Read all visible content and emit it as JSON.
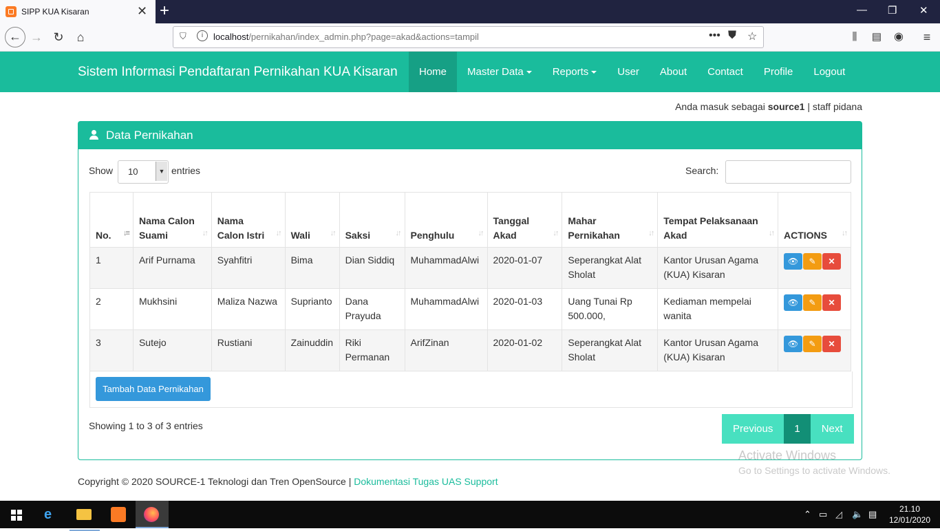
{
  "browser": {
    "tab_title": "SIPP KUA Kisaran",
    "url_host": "localhost",
    "url_path": "/pernikahan/index_admin.php?page=akad&actions=tampil"
  },
  "site": {
    "brand": "Sistem Informasi Pendaftaran Pernikahan KUA Kisaran",
    "menu": [
      "Home",
      "Master Data",
      "Reports",
      "User",
      "About",
      "Contact",
      "Profile",
      "Logout"
    ],
    "login_prefix": "Anda masuk sebagai",
    "login_user": "source1",
    "login_suffix": "| staff pidana"
  },
  "panel": {
    "title": "Data Pernikahan",
    "show_label": "Show",
    "entries_label": "entries",
    "page_length": "10",
    "search_label": "Search:",
    "search_value": ""
  },
  "table": {
    "columns": [
      "No.",
      "Nama Calon Suami",
      "Nama Calon Istri",
      "Wali",
      "Saksi",
      "Penghulu",
      "Tanggal Akad",
      "Mahar Pernikahan",
      "Tempat Pelaksanaan Akad",
      "ACTIONS"
    ],
    "rows": [
      [
        "1",
        "Arif Purnama",
        "Syahfitri",
        "Bima",
        "Dian Siddiq",
        "MuhammadAlwi",
        "2020-01-07",
        "Seperangkat Alat Sholat",
        "Kantor Urusan Agama (KUA) Kisaran"
      ],
      [
        "2",
        "Mukhsini",
        "Maliza Nazwa",
        "Suprianto",
        "Dana Prayuda",
        "MuhammadAlwi",
        "2020-01-03",
        "Uang Tunai Rp 500.000,",
        "Kediaman mempelai wanita"
      ],
      [
        "3",
        "Sutejo",
        "Rustiani",
        "Zainuddin",
        "Riki Permanan",
        "ArifZinan",
        "2020-01-02",
        "Seperangkat Alat Sholat",
        "Kantor Urusan Agama (KUA) Kisaran"
      ]
    ],
    "add_button": "Tambah Data Pernikahan",
    "info": "Showing 1 to 3 of 3 entries",
    "pager": {
      "previous": "Previous",
      "current": "1",
      "next": "Next"
    }
  },
  "footer": {
    "text": "Copyright © 2020 SOURCE-1 Teknologi dan Tren OpenSource |",
    "link": "Dokumentasi Tugas UAS Support"
  },
  "watermark": {
    "line1": "Activate Windows",
    "line2": "Go to Settings to activate Windows."
  },
  "taskbar": {
    "time": "21.10",
    "date": "12/01/2020"
  },
  "colors": {
    "primary": "#1abc9c",
    "primary_dark": "#16a085",
    "view": "#3498db",
    "edit": "#f39c12",
    "delete": "#e74c3c"
  }
}
